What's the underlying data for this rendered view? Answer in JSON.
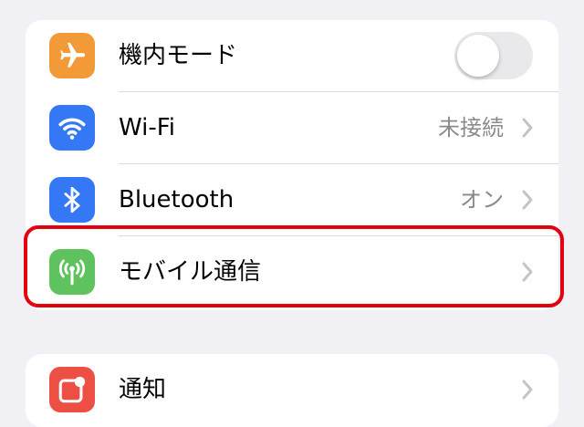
{
  "settings": {
    "group1": [
      {
        "id": "airplane",
        "label": "機内モード",
        "icon": "airplane-icon",
        "icon_color": "#f29a38",
        "control": "toggle",
        "toggle_on": false
      },
      {
        "id": "wifi",
        "label": "Wi-Fi",
        "icon": "wifi-icon",
        "icon_color": "#3478f6",
        "value": "未接続",
        "control": "chevron"
      },
      {
        "id": "bluetooth",
        "label": "Bluetooth",
        "icon": "bluetooth-icon",
        "icon_color": "#3478f6",
        "value": "オン",
        "control": "chevron"
      },
      {
        "id": "cellular",
        "label": "モバイル通信",
        "icon": "antenna-icon",
        "icon_color": "#5ec35f",
        "control": "chevron",
        "highlighted": true
      }
    ],
    "group2": [
      {
        "id": "notifications",
        "label": "通知",
        "icon": "notifications-icon",
        "icon_color": "#ee4f44",
        "control": "chevron"
      }
    ]
  },
  "colors": {
    "background": "#f0f0f5",
    "highlight_border": "#e3000f",
    "secondary_text": "#8a8a8e",
    "chevron": "#c4c4c7"
  }
}
